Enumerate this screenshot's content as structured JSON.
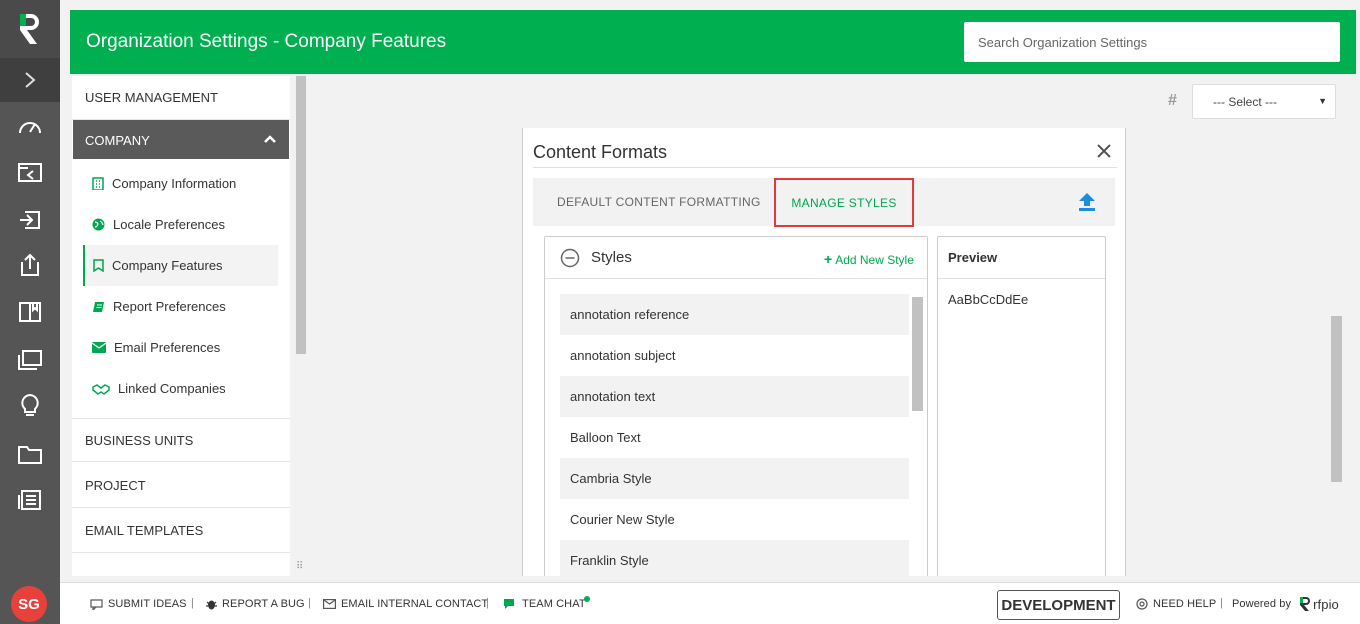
{
  "header": {
    "title": "Organization Settings - Company Features",
    "search_placeholder": "Search Organization Settings"
  },
  "sidebar_rail": {
    "icons": [
      "rfpio-logo-icon",
      "expand-chevron-icon",
      "dashboard-icon",
      "projects-icon",
      "import-icon",
      "export-icon",
      "library-icon",
      "documents-icon",
      "ideas-icon",
      "folder-icon",
      "reports-icon"
    ],
    "avatar_initials": "SG"
  },
  "nav": {
    "user_management": "USER MANAGEMENT",
    "company": "COMPANY",
    "items": [
      {
        "label": "Company Information",
        "icon": "building-icon"
      },
      {
        "label": "Locale Preferences",
        "icon": "globe-icon"
      },
      {
        "label": "Company Features",
        "icon": "bookmark-icon"
      },
      {
        "label": "Report Preferences",
        "icon": "book-icon"
      },
      {
        "label": "Email Preferences",
        "icon": "envelope-icon"
      },
      {
        "label": "Linked Companies",
        "icon": "handshake-icon"
      }
    ],
    "business_units": "BUSINESS UNITS",
    "project": "PROJECT",
    "email_templates": "EMAIL TEMPLATES"
  },
  "select": {
    "value": "--- Select ---",
    "hash": "#"
  },
  "modal": {
    "title": "Content Formats",
    "tabs": [
      "DEFAULT CONTENT FORMATTING",
      "MANAGE STYLES"
    ],
    "styles_title": "Styles",
    "add_new_style": "Add New Style",
    "styles": [
      "annotation reference",
      "annotation subject",
      "annotation text",
      "Balloon Text",
      "Cambria Style",
      "Courier New Style",
      "Franklin Style"
    ],
    "preview_title": "Preview",
    "preview_text": "AaBbCcDdEe"
  },
  "footer": {
    "submit_ideas": "SUBMIT IDEAS",
    "report_bug": "REPORT A BUG",
    "email_contact": "EMAIL INTERNAL CONTACT",
    "team_chat": "TEAM CHAT",
    "sep": "|",
    "environment": "DEVELOPMENT",
    "need_help": "NEED HELP",
    "powered_by": "Powered by",
    "brand": "rfpio"
  },
  "colors": {
    "brand_green": "#00b050",
    "rail": "#555555",
    "highlight_red": "#e03a3a"
  }
}
